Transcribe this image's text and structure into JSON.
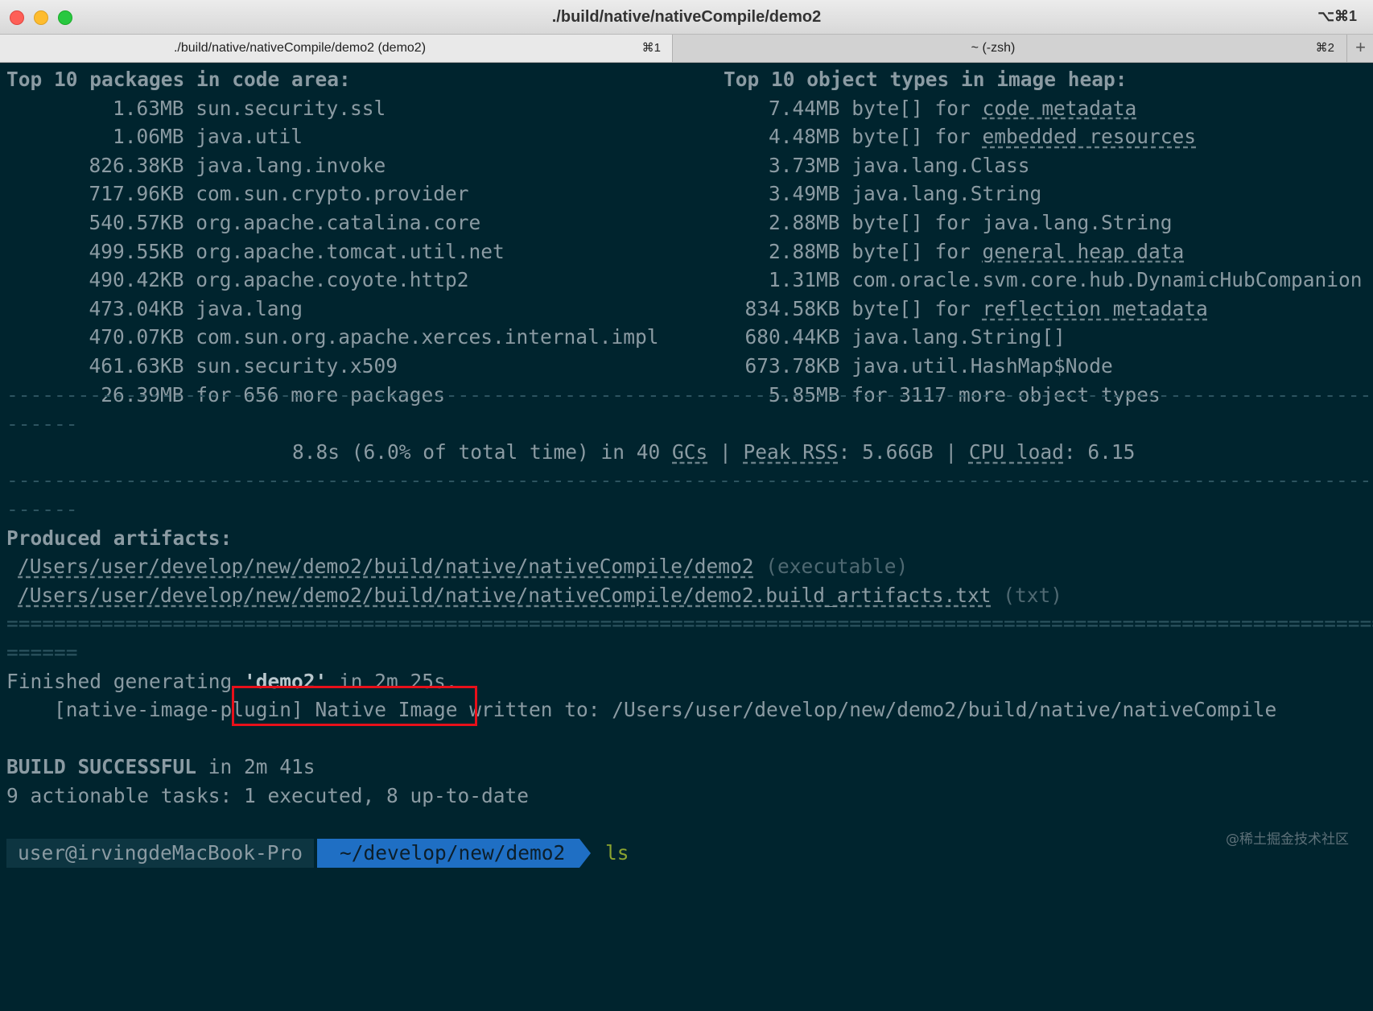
{
  "window": {
    "title": "./build/native/nativeCompile/demo2",
    "shortcut": "⌥⌘1"
  },
  "tabs": [
    {
      "label": "./build/native/nativeCompile/demo2 (demo2)",
      "key": "⌘1"
    },
    {
      "label": "~ (-zsh)",
      "key": "⌘2"
    }
  ],
  "tab_add": "+",
  "packages": {
    "header": "Top 10 packages in code area:",
    "rows": [
      {
        "size": "1.63MB",
        "name": "sun.security.ssl"
      },
      {
        "size": "1.06MB",
        "name": "java.util"
      },
      {
        "size": "826.38KB",
        "name": "java.lang.invoke"
      },
      {
        "size": "717.96KB",
        "name": "com.sun.crypto.provider"
      },
      {
        "size": "540.57KB",
        "name": "org.apache.catalina.core"
      },
      {
        "size": "499.55KB",
        "name": "org.apache.tomcat.util.net"
      },
      {
        "size": "490.42KB",
        "name": "org.apache.coyote.http2"
      },
      {
        "size": "473.04KB",
        "name": "java.lang"
      },
      {
        "size": "470.07KB",
        "name": "com.sun.org.apache.xerces.internal.impl"
      },
      {
        "size": "461.63KB",
        "name": "sun.security.x509"
      },
      {
        "size": "26.39MB",
        "name": "for 656 more packages"
      }
    ]
  },
  "objects": {
    "header": "Top 10 object types in image heap:",
    "rows": [
      {
        "size": "7.44MB",
        "prefix": "byte[] for ",
        "name": "code metadata"
      },
      {
        "size": "4.48MB",
        "prefix": "byte[] for ",
        "name": "embedded resources"
      },
      {
        "size": "3.73MB",
        "prefix": "java.lang.Class",
        "name": ""
      },
      {
        "size": "3.49MB",
        "prefix": "java.lang.String",
        "name": ""
      },
      {
        "size": "2.88MB",
        "prefix": "byte[] for java.lang.String",
        "name": ""
      },
      {
        "size": "2.88MB",
        "prefix": "byte[] for ",
        "name": "general heap data"
      },
      {
        "size": "1.31MB",
        "prefix": "com.oracle.svm.core.hub.DynamicHubCompanion",
        "name": ""
      },
      {
        "size": "834.58KB",
        "prefix": "byte[] for ",
        "name": "reflection metadata"
      },
      {
        "size": "680.44KB",
        "prefix": "java.lang.String[]",
        "name": ""
      },
      {
        "size": "673.78KB",
        "prefix": "java.util.HashMap$Node",
        "name": ""
      },
      {
        "size": "5.85MB",
        "prefix": "for 3117 more object types",
        "name": ""
      }
    ]
  },
  "separator_dash": "------------------------------------------------------------------------------------------------------------------------",
  "separator_dash_tail": "------",
  "separator_eq": "========================================================================================================================",
  "separator_eq_tail": "======",
  "stats": {
    "gc_time": "8.8s (6.0% of total time) in 40 ",
    "gcs": "GCs",
    "pipe1": " | ",
    "peak_rss_label": "Peak RSS",
    "peak_rss_value": ": 5.66GB",
    "pipe2": " | ",
    "cpu_label": "CPU load",
    "cpu_value": ": 6.15"
  },
  "artifacts": {
    "header": "Produced artifacts:",
    "items": [
      {
        "path": "/Users/user/develop/new/demo2/build/native/nativeCompile/demo2",
        "kind": "(executable)"
      },
      {
        "path": "/Users/user/develop/new/demo2/build/native/nativeCompile/demo2.build_artifacts.txt",
        "kind": "(txt)"
      }
    ]
  },
  "finished": {
    "prefix": "Finished generating ",
    "name": "'demo2'",
    "suffix": " in 2m 25s."
  },
  "plugin_line": "    [native-image-plugin] Native Image written to: /Users/user/develop/new/demo2/build/native/nativeCompile",
  "build": {
    "status": "BUILD SUCCESSFUL",
    "duration": " in 2m 41s",
    "tasks": "9 actionable tasks: 1 executed, 8 up-to-date"
  },
  "prompt": {
    "user": "user@irvingdeMacBook-Pro",
    "path": "~/develop/new/demo2",
    "command": "ls"
  },
  "watermark": "@稀土掘金技术社区"
}
